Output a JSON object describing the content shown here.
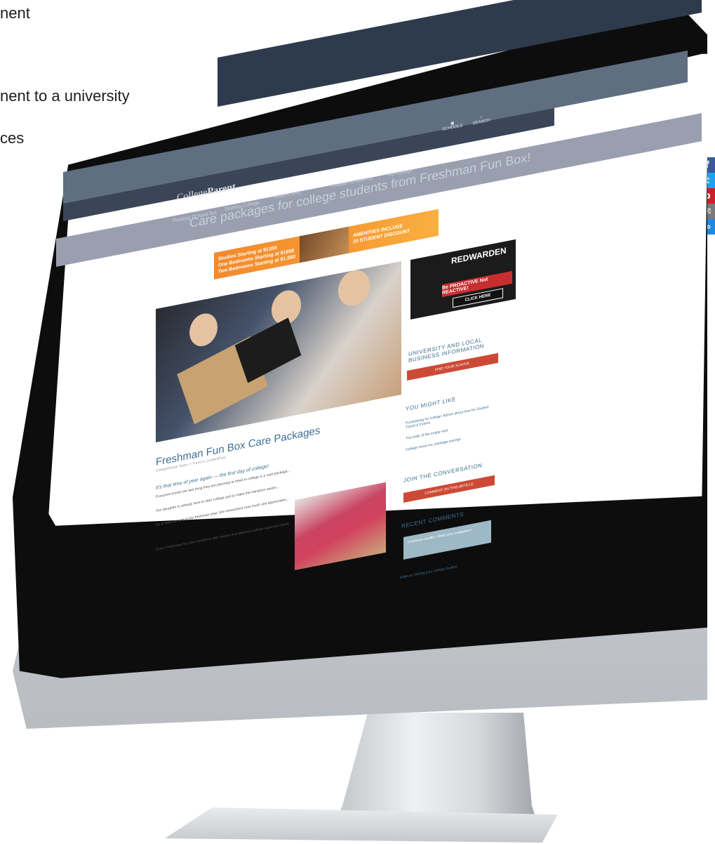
{
  "left_text": {
    "line1": "nent",
    "line2": "nent to a university",
    "line3": "ces"
  },
  "social": [
    "f",
    "t",
    "p",
    "✉",
    "∞"
  ],
  "site": {
    "logo_pre": "College",
    "logo_brand": "Parent",
    "nav": [
      {
        "label": "Thinking I'll have fun",
        "sub": "Life is your success"
      },
      {
        "label": "Starting College",
        "sub": "Understanding how to manage"
      },
      {
        "label": "What is Best",
        "sub": "Whatever they can be"
      },
      {
        "label": "Prepare to Give Up",
        "sub": "Letting go: parenting a student"
      },
      {
        "label": "My College",
        "sub": "Personalize your profile"
      }
    ],
    "icons": [
      {
        "icon": "school-icon",
        "label": "SCHOOLS"
      },
      {
        "icon": "search-icon",
        "label": "SEARCH"
      }
    ],
    "tagline": "Care packages for college students from Freshman Fun Box!"
  },
  "banner": {
    "line1": "Studios Starting at $1355",
    "line2": "One Bedrooms Starting at $1658",
    "line3": "Two Bedrooms Starting at $1,550",
    "cta": "AMENITIES INCLUDE",
    "promo": "20 STUDENT DISCOUNT"
  },
  "article": {
    "title": "Freshman Fun Box Care Packages",
    "meta": "CollegeParent Team / / Trend in ContentPrep",
    "lede": "It's that time of year again — the first day of college!",
    "p1": "Everyone knows the last thing they are planning to head to college is a care package...",
    "p2": "Our daughter is already here to start college and to make the transition easier...",
    "p3": "So in what we see in the freshman year, she remembers how much she appreciates...",
    "p4": "Every Freshman Fun Box overflows with unique and delicious college-approved items..."
  },
  "sidebar": {
    "ad_brand": "REDWARDEN",
    "ad_tag": "Be PROACTIVE Not REACTIVE!",
    "ad_cta": "CLICK HERE",
    "h1": "UNIVERSITY AND LOCAL BUSINESS INFORMATION",
    "btn1": "FIND YOUR SCHOOL",
    "h2": "YOU MIGHT LIKE",
    "links": [
      "Fundraising for college: Advice about how for Student Travel & Events",
      "The trials of the empty nest",
      "College move-ins: package savings"
    ],
    "h3": "JOIN THE CONVERSATION",
    "btn2": "COMMENT ON THIS ARTICLE",
    "h4": "RECENT COMMENTS",
    "comment1": "Freshman twelfth, I liked your evaluation!",
    "comment2": "Kelle on Visiting your college student"
  },
  "colors": {
    "header_dark": "#2e3b4c",
    "accent_link": "#3d6f91",
    "accent_button": "#cc4a35",
    "banner_orange": "#f28a2e",
    "facebook": "#3b5998",
    "twitter": "#1da1f2",
    "pinterest": "#cb2027",
    "email": "#7a7a7a",
    "share": "#1e88e5"
  }
}
